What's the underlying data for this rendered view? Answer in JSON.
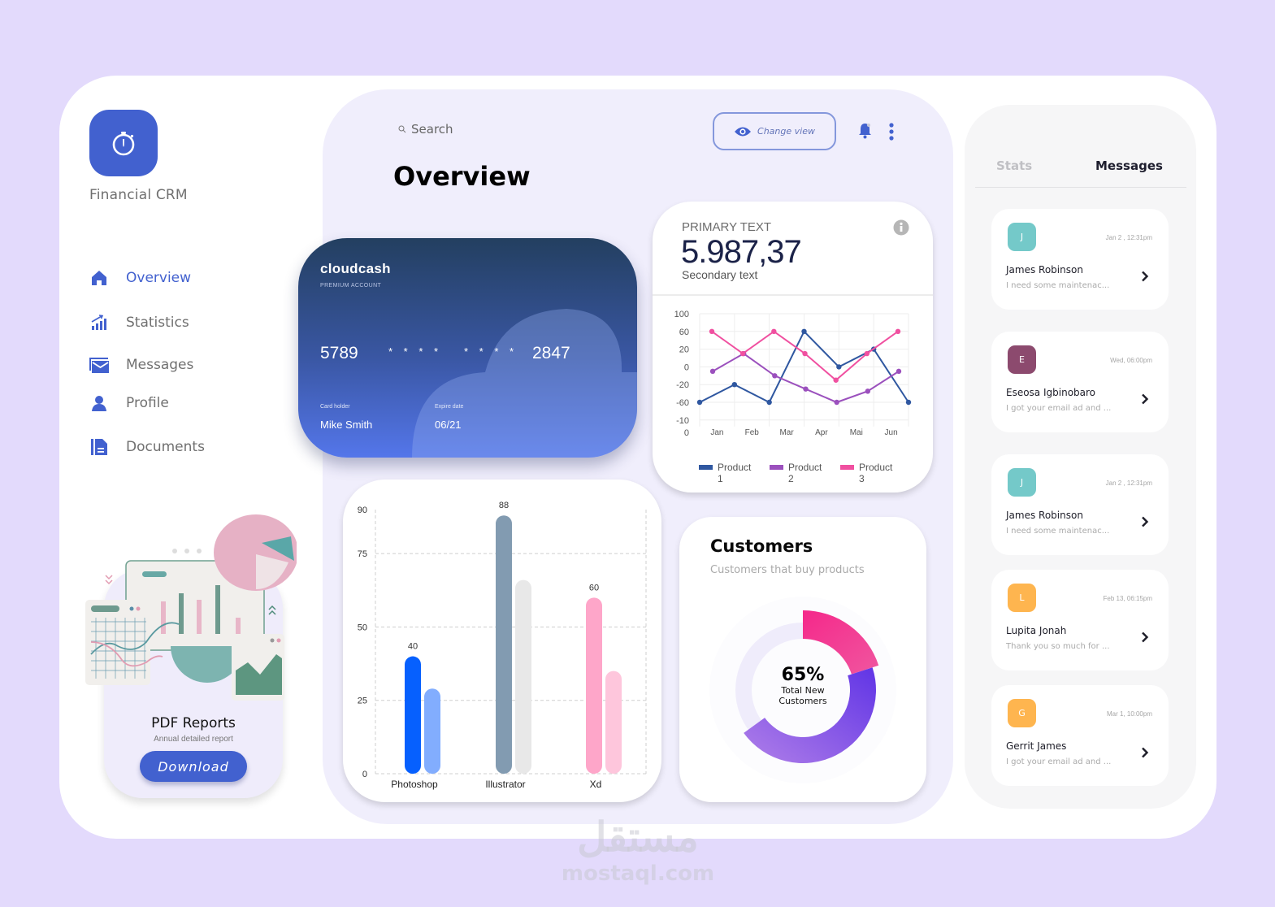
{
  "app": {
    "title": "Financial CRM",
    "logo_icon": "stopwatch-icon",
    "brand_color": "#4261cf"
  },
  "sidebar": {
    "items": [
      {
        "label": "Overview",
        "icon": "home-icon",
        "active": true
      },
      {
        "label": "Statistics",
        "icon": "bar-chart-icon",
        "active": false
      },
      {
        "label": "Messages",
        "icon": "mail-icon",
        "active": false
      },
      {
        "label": "Profile",
        "icon": "user-icon",
        "active": false
      },
      {
        "label": "Documents",
        "icon": "document-icon",
        "active": false
      }
    ]
  },
  "pdf_report": {
    "title": "PDF Reports",
    "subtitle": "Annual detailed report",
    "button_label": "Download"
  },
  "header": {
    "search_placeholder": "Search",
    "change_view_label": "Change view",
    "page_title": "Overview"
  },
  "credit_card": {
    "brand": "cloudcash",
    "tier": "PREMIUM ACCOUNT",
    "number_groups": [
      "5789",
      "* * * *",
      "* * * *",
      "2847"
    ],
    "holder_label": "Card holder",
    "holder_name": "Mike Smith",
    "expiry_label": "Expire date",
    "expiry": "06/21"
  },
  "stat_card": {
    "label": "PRIMARY TEXT",
    "value": "5.987,37",
    "secondary": "Secondary text"
  },
  "chart_data": [
    {
      "type": "line",
      "title": "",
      "x": [
        "Jan",
        "Feb",
        "Mar",
        "Apr",
        "Mai",
        "Jun"
      ],
      "y_tick_labels": [
        "100",
        "60",
        "20",
        "0",
        "-20",
        "-60",
        "-10",
        "0"
      ],
      "grid": true,
      "legend": "bottom",
      "series": [
        {
          "name": "Product 1",
          "color": "#2f57a0",
          "values": [
            -60,
            -20,
            -60,
            60,
            0,
            20,
            -60
          ]
        },
        {
          "name": "Product 2",
          "color": "#9b50bd",
          "values": [
            -5,
            15,
            -10,
            -30,
            -60,
            -35,
            -5
          ]
        },
        {
          "name": "Product 3",
          "color": "#f050a0",
          "values": [
            60,
            15,
            60,
            15,
            -15,
            15,
            60
          ]
        }
      ]
    },
    {
      "type": "bar",
      "title": "",
      "categories": [
        "Photoshop",
        "Illustrator",
        "Xd"
      ],
      "ylim": [
        0,
        90
      ],
      "y_ticks": [
        0,
        25,
        50,
        75,
        90
      ],
      "grid": true,
      "series": [
        {
          "name": "primary",
          "values": [
            40,
            88,
            60
          ],
          "colors": [
            "#0660fe",
            "#829bb1",
            "#fea6c9"
          ],
          "labels": [
            "40",
            "88",
            "60"
          ]
        },
        {
          "name": "secondary",
          "values": [
            29,
            66,
            35
          ],
          "colors": [
            "#82adfe",
            "#e8e8e8",
            "#fec6dc"
          ]
        }
      ]
    },
    {
      "type": "pie",
      "title": "Customers",
      "subtitle": "Customers that buy products",
      "center_value": "65%",
      "center_label": "Total New Customers",
      "total_percent": 65,
      "segments": [
        {
          "name": "segment-pink",
          "percent": 20,
          "color": "#f2338f"
        },
        {
          "name": "segment-purple",
          "percent": 45,
          "color": "#6a3ce8"
        }
      ]
    }
  ],
  "right_panel": {
    "tabs": [
      {
        "label": "Stats",
        "active": false
      },
      {
        "label": "Messages",
        "active": true
      }
    ],
    "messages": [
      {
        "initial": "J",
        "name": "James Robinson",
        "time": "Jan 2 , 12:31pm",
        "preview": "I need some maintenac...",
        "color": "#74c9c9"
      },
      {
        "initial": "E",
        "name": "Eseosa Igbinobaro",
        "time": "Wed, 06:00pm",
        "preview": "I got your email ad and ...",
        "color": "#8c4a6e"
      },
      {
        "initial": "J",
        "name": "James Robinson",
        "time": "Jan 2 , 12:31pm",
        "preview": "I need some maintenac...",
        "color": "#74c9c9"
      },
      {
        "initial": "L",
        "name": "Lupita Jonah",
        "time": "Feb 13, 06:15pm",
        "preview": "Thank you so much for ...",
        "color": "#feb54f"
      },
      {
        "initial": "G",
        "name": "Gerrit James",
        "time": "Mar 1, 10:00pm",
        "preview": "I got your email ad and ...",
        "color": "#feb54f"
      }
    ]
  },
  "watermark": {
    "arabic": "مستقل",
    "latin": "mostaql.com"
  }
}
